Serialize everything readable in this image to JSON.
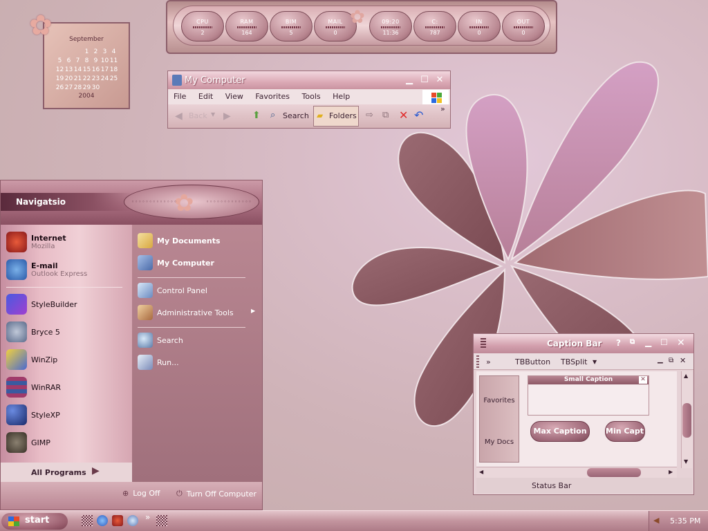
{
  "colors": {
    "accent": "#a66a7c",
    "dark": "#6e3a4a",
    "light": "#f0d0d6"
  },
  "meters": [
    {
      "label": "CPU",
      "value": "2"
    },
    {
      "label": "RAM",
      "value": "164"
    },
    {
      "label": "BIM",
      "value": "5"
    },
    {
      "label": "MAIL",
      "value": "0"
    },
    {
      "label": "09:20",
      "value": "11:36"
    },
    {
      "label": "C:",
      "value": "787"
    },
    {
      "label": "IN",
      "value": "0"
    },
    {
      "label": "OUT",
      "value": "0"
    }
  ],
  "calendar": {
    "month": "September",
    "rows": [
      [
        "",
        "",
        "1",
        "2",
        "3",
        "4"
      ],
      [
        "5",
        "6",
        "7",
        "8",
        "9",
        "10",
        "11"
      ],
      [
        "12",
        "13",
        "14",
        "15",
        "16",
        "17",
        "18"
      ],
      [
        "19",
        "20",
        "21",
        "22",
        "23",
        "24",
        "25"
      ],
      [
        "26",
        "27",
        "28",
        "29",
        "30",
        "",
        ""
      ]
    ],
    "year": "2004"
  },
  "explorer": {
    "title": "My Computer",
    "menu": [
      "File",
      "Edit",
      "View",
      "Favorites",
      "Tools",
      "Help"
    ],
    "back": "Back",
    "search": "Search",
    "folders": "Folders"
  },
  "startmenu": {
    "user": "Navigatsio",
    "pinned": [
      {
        "title": "Internet",
        "sub": "Mozilla"
      },
      {
        "title": "E-mail",
        "sub": "Outlook Express"
      }
    ],
    "recent": [
      "StyleBuilder",
      "Bryce 5",
      "WinZip",
      "WinRAR",
      "StyleXP",
      "GIMP"
    ],
    "all_programs": "All Programs",
    "right": [
      {
        "label": "My Documents",
        "bold": true
      },
      {
        "label": "My Computer",
        "bold": true
      },
      {
        "label": "Control Panel",
        "bold": false
      },
      {
        "label": "Administrative Tools",
        "bold": false
      },
      {
        "label": "Search",
        "bold": false
      },
      {
        "label": "Run...",
        "bold": false
      }
    ],
    "logoff": "Log Off",
    "turnoff": "Turn Off Computer"
  },
  "captionwin": {
    "title": "Caption Bar",
    "chevron": "»",
    "tbbutton": "TBButton",
    "tbsplit": "TBSplit",
    "favorites": "Favorites",
    "mydocs": "My Docs",
    "small_caption": "Small Caption",
    "max_caption": "Max Caption",
    "min_caption": "Min Capti",
    "status": "Status Bar"
  },
  "taskbar": {
    "start": "start",
    "time": "5:35 PM"
  }
}
